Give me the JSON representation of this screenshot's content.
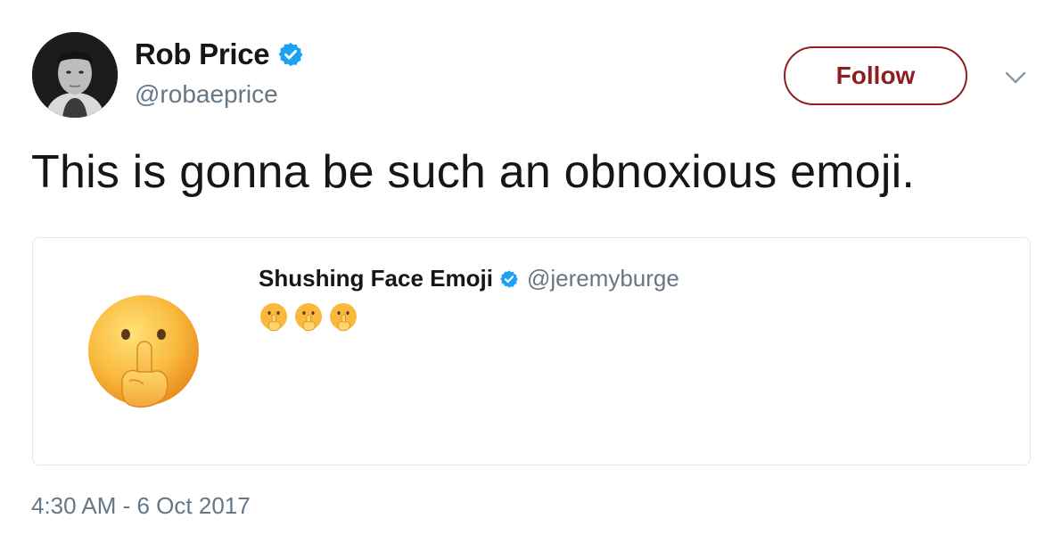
{
  "author": {
    "display_name": "Rob Price",
    "handle": "@robaeprice",
    "verified_icon": "verified-badge-icon"
  },
  "actions": {
    "follow_label": "Follow",
    "menu_icon": "chevron-down-icon"
  },
  "tweet": {
    "text": "This is gonna be such an obnoxious emoji.",
    "timestamp": "4:30 AM - 6 Oct 2017"
  },
  "quoted_tweet": {
    "display_name": "Shushing Face Emoji",
    "handle": "@jeremyburge",
    "verified_icon": "verified-badge-icon",
    "media_icon": "shushing-face-emoji-icon",
    "inline_emoji_icons": [
      "shushing-face-emoji-icon",
      "shushing-face-emoji-icon",
      "shushing-face-emoji-icon"
    ]
  },
  "colors": {
    "follow_accent": "#8c1e24",
    "verified_blue": "#1da1f2",
    "secondary_text": "#657786",
    "primary_text": "#14171a",
    "card_border": "#e1e8ed"
  }
}
